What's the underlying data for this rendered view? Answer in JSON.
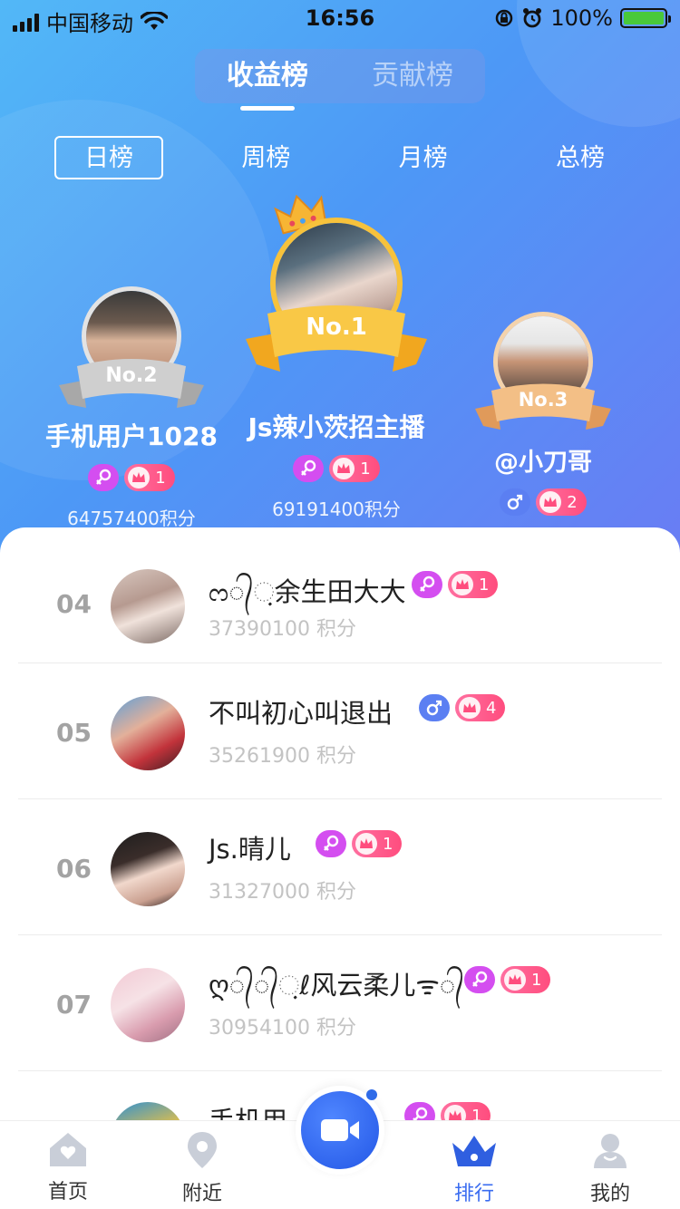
{
  "status_bar": {
    "carrier": "中国移动",
    "time": "16:56",
    "battery": "100%"
  },
  "main_tabs": [
    {
      "label": "收益榜",
      "active": true
    },
    {
      "label": "贡献榜",
      "active": false
    }
  ],
  "period_tabs": [
    {
      "label": "日榜",
      "active": true
    },
    {
      "label": "周榜",
      "active": false
    },
    {
      "label": "月榜",
      "active": false
    },
    {
      "label": "总榜",
      "active": false
    }
  ],
  "podium": {
    "first": {
      "rank_label": "No.1",
      "name": "Js辣小茨招主播",
      "gender": "female",
      "level": "1",
      "score": "69191400积分"
    },
    "second": {
      "rank_label": "No.2",
      "name": "手机用户1028",
      "gender": "female",
      "level": "1",
      "score": "64757400积分"
    },
    "third": {
      "rank_label": "No.3",
      "name": "@小刀哥",
      "gender": "male",
      "level": "2",
      "score": ""
    }
  },
  "list": [
    {
      "rank": "04",
      "name": "ᦂ᭄ᨘ余生田大大",
      "gender": "female",
      "level": "1",
      "score": "37390100 积分"
    },
    {
      "rank": "05",
      "name": "不叫初心叫退出",
      "gender": "male",
      "level": "4",
      "score": "35261900 积分"
    },
    {
      "rank": "06",
      "name": "Js.晴儿",
      "gender": "female",
      "level": "1",
      "score": "31327000 积分"
    },
    {
      "rank": "07",
      "name": "ღ᭄᭄ᨘℓ风云柔儿ᯤ᭄",
      "gender": "female",
      "level": "1",
      "score": "30954100 积分"
    },
    {
      "rank": "",
      "name": "手机用",
      "gender": "female",
      "level": "1",
      "score": ""
    }
  ],
  "nav": [
    {
      "label": "首页",
      "icon": "home-icon"
    },
    {
      "label": "附近",
      "icon": "location-pin-icon"
    },
    {
      "label": "排行",
      "icon": "crown-icon",
      "active": true
    },
    {
      "label": "我的",
      "icon": "user-icon"
    }
  ],
  "colors": {
    "accent": "#3a6cf0",
    "female_badge": "#d44ef0",
    "male_badge": "#5b7ff2",
    "level_badge": "#ff5a8a",
    "gold": "#f7c23c",
    "silver": "#c9c9c9",
    "bronze": "#f0b97a"
  }
}
